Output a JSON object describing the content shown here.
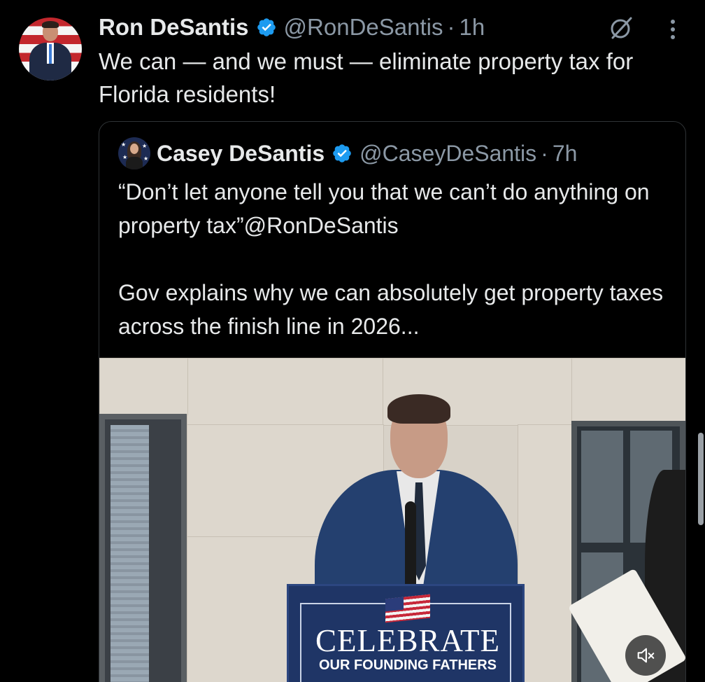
{
  "tweet": {
    "author_name": "Ron DeSantis",
    "author_handle": "@RonDeSantis",
    "separator": "·",
    "time": "1h",
    "text": "We can — and we must — eliminate property tax for Florida residents!",
    "icons": {
      "verified": "verified-badge-icon",
      "grok": "grok-icon",
      "more": "more-options-icon"
    }
  },
  "quoted_tweet": {
    "author_name": "Casey DeSantis",
    "author_handle": "@CaseyDeSantis",
    "separator": "·",
    "time": "7h",
    "text_line1": "“Don’t let anyone tell you that we can’t do anything on property tax”@RonDeSantis",
    "text_line2": "Gov explains why we can absolutely get property taxes across the finish line in 2026...",
    "media": {
      "podium_title": "CELEBRATE",
      "podium_subtitle": "OUR FOUNDING FATHERS",
      "mute_icon": "volume-mute-icon"
    }
  },
  "colors": {
    "background": "#000000",
    "text": "#e7e9ea",
    "muted": "#8b98a5",
    "verified": "#1d9bf0",
    "border": "#2f3336"
  }
}
